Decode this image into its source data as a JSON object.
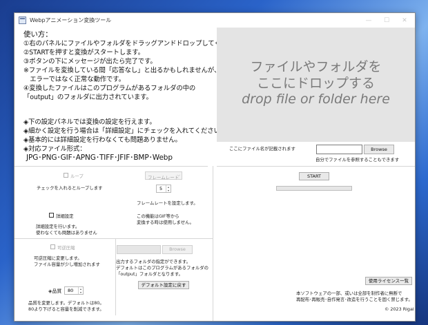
{
  "window": {
    "title": "Webpアニメーション変換ツール",
    "minimize": "—",
    "maximize": "☐",
    "close": "✕"
  },
  "instructions": {
    "heading": "使い方：",
    "lines": [
      "①右のパネルにファイルやフォルダをドラッグアンドドロップしてください。",
      "②STARTを押すと変換がスタートします。",
      "③ボタンの下にメッセージが出たら完了です。",
      "※ファイルを変換している間「応答なし」と出るかもしれませんが、",
      "　エラーではなく正常な動作です。",
      "④変換したファイルはこのプログラムがあるフォルダの中の",
      "「output」のフォルダに出力されています。"
    ],
    "notes": [
      "◈下の設定パネルでは変換の設定を行えます。",
      "◈細かく設定を行う場合は「詳細設定」にチェックを入れてください。",
      "◈基本的には詳細設定を行わなくても問題ありません。",
      "◈対応ファイル形式：",
      "JPG･PNG･GIF･APNG･TIFF･JFIF･BMP･Webp"
    ]
  },
  "dropzone": {
    "line1": "ファイルやフォルダを",
    "line2": "ここにドロップする",
    "line3": "drop file or folder here"
  },
  "file": {
    "label": "ここにファイル名が記載されます",
    "browse": "Browse",
    "hint": "自分でファイルを参照することもできます"
  },
  "start": {
    "label": "START",
    "progress": 0
  },
  "loop": {
    "label": "ループ",
    "desc": "チェックを入れるとループします"
  },
  "framerate": {
    "placeholder": "フレームレート",
    "value": "5",
    "desc": "フレームレートを設定します。",
    "note1": "この機能はGIF等から",
    "note2": "変換する時は使用しません。"
  },
  "advanced": {
    "label": "詳細設定",
    "desc1": "詳細設定を行います。",
    "desc2": "使わなくても問題はありません"
  },
  "lossless": {
    "label": "可逆圧縮",
    "desc1": "可逆圧縮に変更します。",
    "desc2": "ファイル容量が少し増加されます"
  },
  "output": {
    "browse": "Browse",
    "desc1": "出力するフォルダの指定ができます。",
    "desc2": "デフォルトはこのプログラムがあるフォルダの",
    "desc3": "「output」フォルダとなります。",
    "reset": "デフォルト設定に戻す"
  },
  "quality": {
    "label": "◈品質",
    "value": "80",
    "desc1": "品質を変更します。デフォルトは80。",
    "desc2": "80より下げると容量を削減できます。"
  },
  "license": {
    "button": "使用ライセンス一覧",
    "text1": "本ソフトウェアの一部、或いは全部を制作者に無断で",
    "text2": "再配布･再販売･自作発言･改造を行うことを固く禁じます。",
    "copyright": "© 2023 Rigal"
  }
}
